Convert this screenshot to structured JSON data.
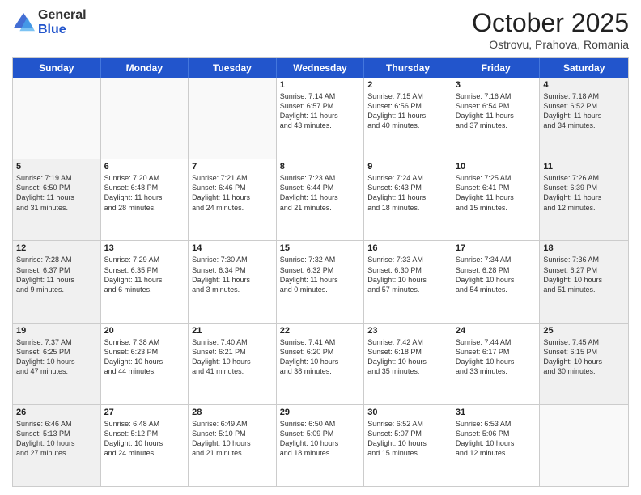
{
  "logo": {
    "general": "General",
    "blue": "Blue"
  },
  "header": {
    "month": "October 2025",
    "location": "Ostrovu, Prahova, Romania"
  },
  "weekdays": [
    "Sunday",
    "Monday",
    "Tuesday",
    "Wednesday",
    "Thursday",
    "Friday",
    "Saturday"
  ],
  "rows": [
    [
      {
        "day": "",
        "text": "",
        "empty": true
      },
      {
        "day": "",
        "text": "",
        "empty": true
      },
      {
        "day": "",
        "text": "",
        "empty": true
      },
      {
        "day": "1",
        "text": "Sunrise: 7:14 AM\nSunset: 6:57 PM\nDaylight: 11 hours\nand 43 minutes."
      },
      {
        "day": "2",
        "text": "Sunrise: 7:15 AM\nSunset: 6:56 PM\nDaylight: 11 hours\nand 40 minutes."
      },
      {
        "day": "3",
        "text": "Sunrise: 7:16 AM\nSunset: 6:54 PM\nDaylight: 11 hours\nand 37 minutes."
      },
      {
        "day": "4",
        "text": "Sunrise: 7:18 AM\nSunset: 6:52 PM\nDaylight: 11 hours\nand 34 minutes.",
        "shaded": true
      }
    ],
    [
      {
        "day": "5",
        "text": "Sunrise: 7:19 AM\nSunset: 6:50 PM\nDaylight: 11 hours\nand 31 minutes.",
        "shaded": true
      },
      {
        "day": "6",
        "text": "Sunrise: 7:20 AM\nSunset: 6:48 PM\nDaylight: 11 hours\nand 28 minutes."
      },
      {
        "day": "7",
        "text": "Sunrise: 7:21 AM\nSunset: 6:46 PM\nDaylight: 11 hours\nand 24 minutes."
      },
      {
        "day": "8",
        "text": "Sunrise: 7:23 AM\nSunset: 6:44 PM\nDaylight: 11 hours\nand 21 minutes."
      },
      {
        "day": "9",
        "text": "Sunrise: 7:24 AM\nSunset: 6:43 PM\nDaylight: 11 hours\nand 18 minutes."
      },
      {
        "day": "10",
        "text": "Sunrise: 7:25 AM\nSunset: 6:41 PM\nDaylight: 11 hours\nand 15 minutes."
      },
      {
        "day": "11",
        "text": "Sunrise: 7:26 AM\nSunset: 6:39 PM\nDaylight: 11 hours\nand 12 minutes.",
        "shaded": true
      }
    ],
    [
      {
        "day": "12",
        "text": "Sunrise: 7:28 AM\nSunset: 6:37 PM\nDaylight: 11 hours\nand 9 minutes.",
        "shaded": true
      },
      {
        "day": "13",
        "text": "Sunrise: 7:29 AM\nSunset: 6:35 PM\nDaylight: 11 hours\nand 6 minutes."
      },
      {
        "day": "14",
        "text": "Sunrise: 7:30 AM\nSunset: 6:34 PM\nDaylight: 11 hours\nand 3 minutes."
      },
      {
        "day": "15",
        "text": "Sunrise: 7:32 AM\nSunset: 6:32 PM\nDaylight: 11 hours\nand 0 minutes."
      },
      {
        "day": "16",
        "text": "Sunrise: 7:33 AM\nSunset: 6:30 PM\nDaylight: 10 hours\nand 57 minutes."
      },
      {
        "day": "17",
        "text": "Sunrise: 7:34 AM\nSunset: 6:28 PM\nDaylight: 10 hours\nand 54 minutes."
      },
      {
        "day": "18",
        "text": "Sunrise: 7:36 AM\nSunset: 6:27 PM\nDaylight: 10 hours\nand 51 minutes.",
        "shaded": true
      }
    ],
    [
      {
        "day": "19",
        "text": "Sunrise: 7:37 AM\nSunset: 6:25 PM\nDaylight: 10 hours\nand 47 minutes.",
        "shaded": true
      },
      {
        "day": "20",
        "text": "Sunrise: 7:38 AM\nSunset: 6:23 PM\nDaylight: 10 hours\nand 44 minutes."
      },
      {
        "day": "21",
        "text": "Sunrise: 7:40 AM\nSunset: 6:21 PM\nDaylight: 10 hours\nand 41 minutes."
      },
      {
        "day": "22",
        "text": "Sunrise: 7:41 AM\nSunset: 6:20 PM\nDaylight: 10 hours\nand 38 minutes."
      },
      {
        "day": "23",
        "text": "Sunrise: 7:42 AM\nSunset: 6:18 PM\nDaylight: 10 hours\nand 35 minutes."
      },
      {
        "day": "24",
        "text": "Sunrise: 7:44 AM\nSunset: 6:17 PM\nDaylight: 10 hours\nand 33 minutes."
      },
      {
        "day": "25",
        "text": "Sunrise: 7:45 AM\nSunset: 6:15 PM\nDaylight: 10 hours\nand 30 minutes.",
        "shaded": true
      }
    ],
    [
      {
        "day": "26",
        "text": "Sunrise: 6:46 AM\nSunset: 5:13 PM\nDaylight: 10 hours\nand 27 minutes.",
        "shaded": true
      },
      {
        "day": "27",
        "text": "Sunrise: 6:48 AM\nSunset: 5:12 PM\nDaylight: 10 hours\nand 24 minutes."
      },
      {
        "day": "28",
        "text": "Sunrise: 6:49 AM\nSunset: 5:10 PM\nDaylight: 10 hours\nand 21 minutes."
      },
      {
        "day": "29",
        "text": "Sunrise: 6:50 AM\nSunset: 5:09 PM\nDaylight: 10 hours\nand 18 minutes."
      },
      {
        "day": "30",
        "text": "Sunrise: 6:52 AM\nSunset: 5:07 PM\nDaylight: 10 hours\nand 15 minutes."
      },
      {
        "day": "31",
        "text": "Sunrise: 6:53 AM\nSunset: 5:06 PM\nDaylight: 10 hours\nand 12 minutes."
      },
      {
        "day": "",
        "text": "",
        "empty": true
      }
    ]
  ]
}
